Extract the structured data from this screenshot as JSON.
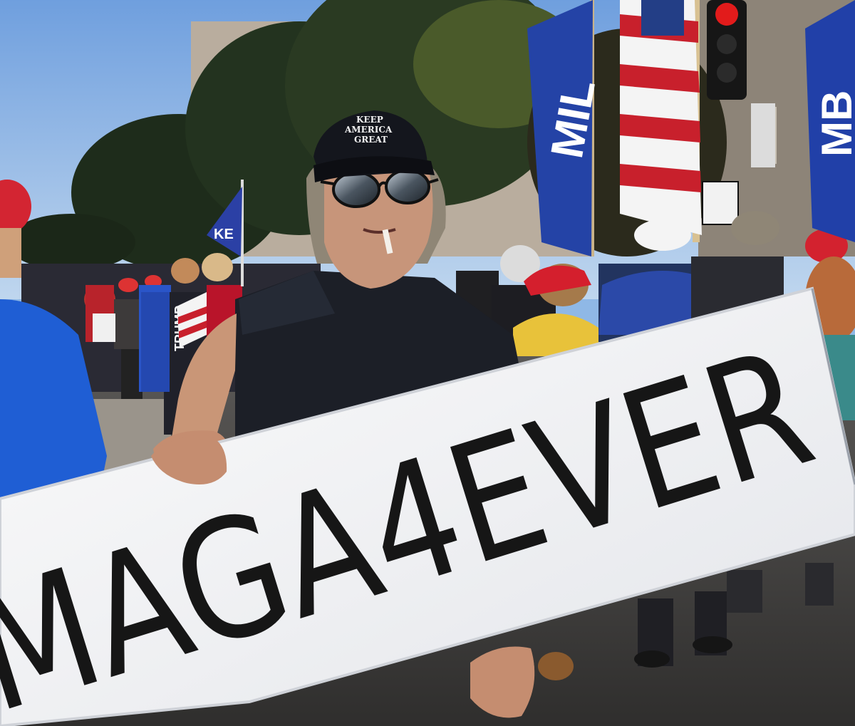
{
  "scene": {
    "description_type": "photo",
    "palette": {
      "sky": "#8fb8e6",
      "foliage": "#1c2a1a",
      "crowd_red": "#c4222e",
      "flag_blue": "#1f3f9c",
      "sign_white": "#f4f4f4",
      "sign_text": "#161616",
      "hoodie": "#1a1d24"
    }
  },
  "sign": {
    "text": "MAGA4EVER"
  },
  "hat": {
    "line1": "KEEP",
    "line2": "AMERICA",
    "line3": "GREAT"
  },
  "background_signs": {
    "trump_banner": "TRUMP",
    "flag_left_partial": "KE",
    "flag_center_partial": "MIL",
    "flag_right_partial": "MB"
  }
}
